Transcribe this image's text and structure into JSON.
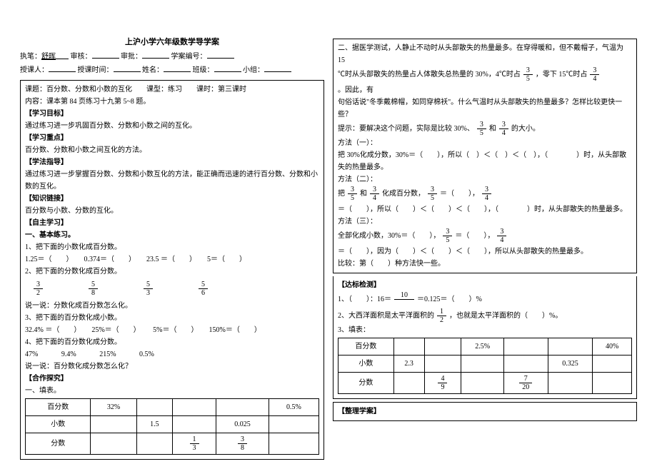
{
  "title": "上沪小学六年级数学导学案",
  "header": {
    "l1_a": "执笔：",
    "l1_a_val": "舒晖",
    "l1_b": "审核：",
    "l1_c": "审批：",
    "l1_d": "学案编号：",
    "l2_a": "授课人：",
    "l2_b": "授课时间：",
    "l2_c": "姓名：",
    "l2_d": "班级：",
    "l2_e": "小组：",
    "l3_a": "课题：百分数、分数和小数的互化",
    "l3_b": "课型：练习",
    "l3_c": "课时：第三课时",
    "l4": "内容：课本第 84 页练习十九第 5~8 题。"
  },
  "left": {
    "s1": "【学习目标】",
    "s1t": "通过练习进一步巩固百分数、分数和小数之间的互化。",
    "s2": "【学习重点】",
    "s2t": "百分数、分数和小数之间互化的方法。",
    "s3": "【学法指导】",
    "s3t": "通过练习进一步掌握百分数、分数和小数互化的方法，能正确而迅速的进行百分数、分数和小数的互化。",
    "s4": "【知识链接】",
    "s4t": "百分数与小数、分数的互化。",
    "s5": "【自主学习】",
    "s5a": "一、基本练习。",
    "s5a1": "1、把下面的小数化成百分数。",
    "s5a1_items": "1.25＝（　　）　　0.374＝（　　）　　23.5 ＝（　　）　　5＝（　　）",
    "s5a2": "2、把下面的分数化成百分数。",
    "frac1_n": "3",
    "frac1_d": "2",
    "frac2_n": "5",
    "frac2_d": "8",
    "frac3_n": "5",
    "frac3_d": "3",
    "frac4_n": "5",
    "frac4_d": "6",
    "s5a3": "说一说：分数化成百分数怎么化。",
    "s5a4": "3、把下面的百分数化成小数。",
    "s5a4_items": "32.4% ＝（　　）　　25%＝（　　）　　 5%＝（　　）　　150%＝（　　）",
    "s5a5": "4、把下面的百分数化成分数。",
    "s5a5_a": "47%",
    "s5a5_b": "9.4%",
    "s5a5_c": "215%",
    "s5a5_d": "0.5%",
    "s5a6": "说一说：百分数化成分数怎么化？",
    "s6": "【合作探究】",
    "s6a": "一、填表。",
    "tbl1": {
      "r1": [
        "百分数",
        "32%",
        "",
        "",
        "",
        "0.5%"
      ],
      "r2": [
        "小数",
        "",
        "1.5",
        "",
        "0.025",
        ""
      ],
      "r3n": "1",
      "r3d": "3",
      "r4n": "3",
      "r4d": "8",
      "r3lbl": "分数"
    }
  },
  "right": {
    "p1": "二、据医学测试，人静止不动时从头部散失的热量最多。在穿得暖和，但不戴帽子，气温为 15",
    "p1b": "℃时从头部散失的热量占人体散失总热量的 30%，4℃时占",
    "p1c": "，零下 15℃时占",
    "p1d": "。因此，有",
    "p1e": "句俗话说\"冬季戴棉帽，如同穿棉袄\"。什么气温时从头部散失的热量最多？怎样比较更快一些？",
    "p1h": "提示：要解决这个问题，实际是比较 30%、",
    "p1h2": "和",
    "p1h3": "的大小。",
    "f35n": "3",
    "f35d": "5",
    "f34n": "3",
    "f34d": "4",
    "m1": "方法（一）：",
    "m1a": "把 30%化成分数，30%＝（　　），所以（　）＜（　）＜（　），（　　　　）时，从头部散失的热量最多。",
    "m2": "方法（二）：",
    "m2a": "把",
    "m2b": "和",
    "m2c": "化成百分数，",
    "m2d": "＝（　　），",
    "m2e": "＝（　　），所以（　　）＜（　　）＜（　　），（　　　　）时，从头部散失的热量最多。",
    "m3": "方法（三）：",
    "m3a": "全部化成小数，30%＝（　　），",
    "m3b": "＝（　　），",
    "m3c": "＝（　　），因为（　　）＜（　　）＜（　　），所以从头部散失的热量最多。",
    "m4": "比较：第（　　）种方法快一些。",
    "db": "【达标检测】",
    "db1a": "1、（　　）：16＝",
    "db1n": "10",
    "db1p": "＝0.125＝（　　）%",
    "db2a": "2、大西洋面积是太平洋面积的",
    "db2n": "1",
    "db2d": "2",
    "db2b": "，也就是太平洋面积的（　　）%。",
    "db3": "3、填表：",
    "tbl2": {
      "r1": [
        "百分数",
        "",
        "",
        "2.5%",
        "",
        "",
        "40%"
      ],
      "r2": [
        "小数",
        "2.3",
        "",
        "",
        "",
        "0.325",
        ""
      ],
      "r3lbl": "分数",
      "f49n": "4",
      "f49d": "9",
      "f720n": "7",
      "f720d": "20"
    },
    "org": "【整理学案】"
  }
}
